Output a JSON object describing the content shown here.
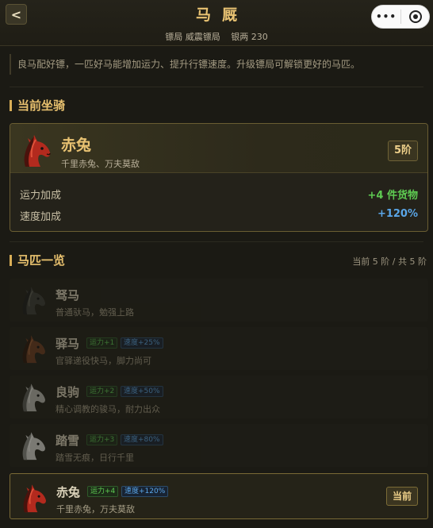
{
  "header": {
    "back_label": "<",
    "title": "马厩",
    "agency": "镖局 威震镖局",
    "silver": "银两 230",
    "capsule_more": "•••",
    "capsule_record_icon": "record-icon"
  },
  "intro": "良马配好镖，一匹好马能增加运力、提升行镖速度。升级镖局可解锁更好的马匹。",
  "current": {
    "section_title": "当前坐骑",
    "name": "赤兔",
    "slogan": "千里赤兔、万夫莫敌",
    "tier": "5阶",
    "stats": [
      {
        "label": "运力加成",
        "value": "+4 件货物"
      },
      {
        "label": "速度加成",
        "value": "+120%"
      }
    ]
  },
  "list": {
    "section_title": "马匹一览",
    "meta": "当前 5 阶 / 共 5 阶",
    "horses": [
      {
        "name": "驽马",
        "slogan": "普通驮马，勉强上路",
        "capacity": "",
        "speed": "",
        "coat": "dark"
      },
      {
        "name": "驿马",
        "slogan": "官驿递役快马，脚力尚可",
        "capacity": "运力+1",
        "speed": "速度+25%",
        "coat": "brown"
      },
      {
        "name": "良驹",
        "slogan": "精心调教的骏马，耐力出众",
        "capacity": "运力+2",
        "speed": "速度+50%",
        "coat": "grey"
      },
      {
        "name": "踏雪",
        "slogan": "踏雪无痕，日行千里",
        "capacity": "运力+3",
        "speed": "速度+80%",
        "coat": "white"
      },
      {
        "name": "赤兔",
        "slogan": "千里赤兔，万夫莫敌",
        "capacity": "运力+4",
        "speed": "速度+120%",
        "coat": "red",
        "action": "当前"
      }
    ]
  },
  "colors": {
    "accent": "#e8c272",
    "green": "#5ecb52",
    "blue": "#5aa6e8",
    "background": "#1b1a14"
  }
}
